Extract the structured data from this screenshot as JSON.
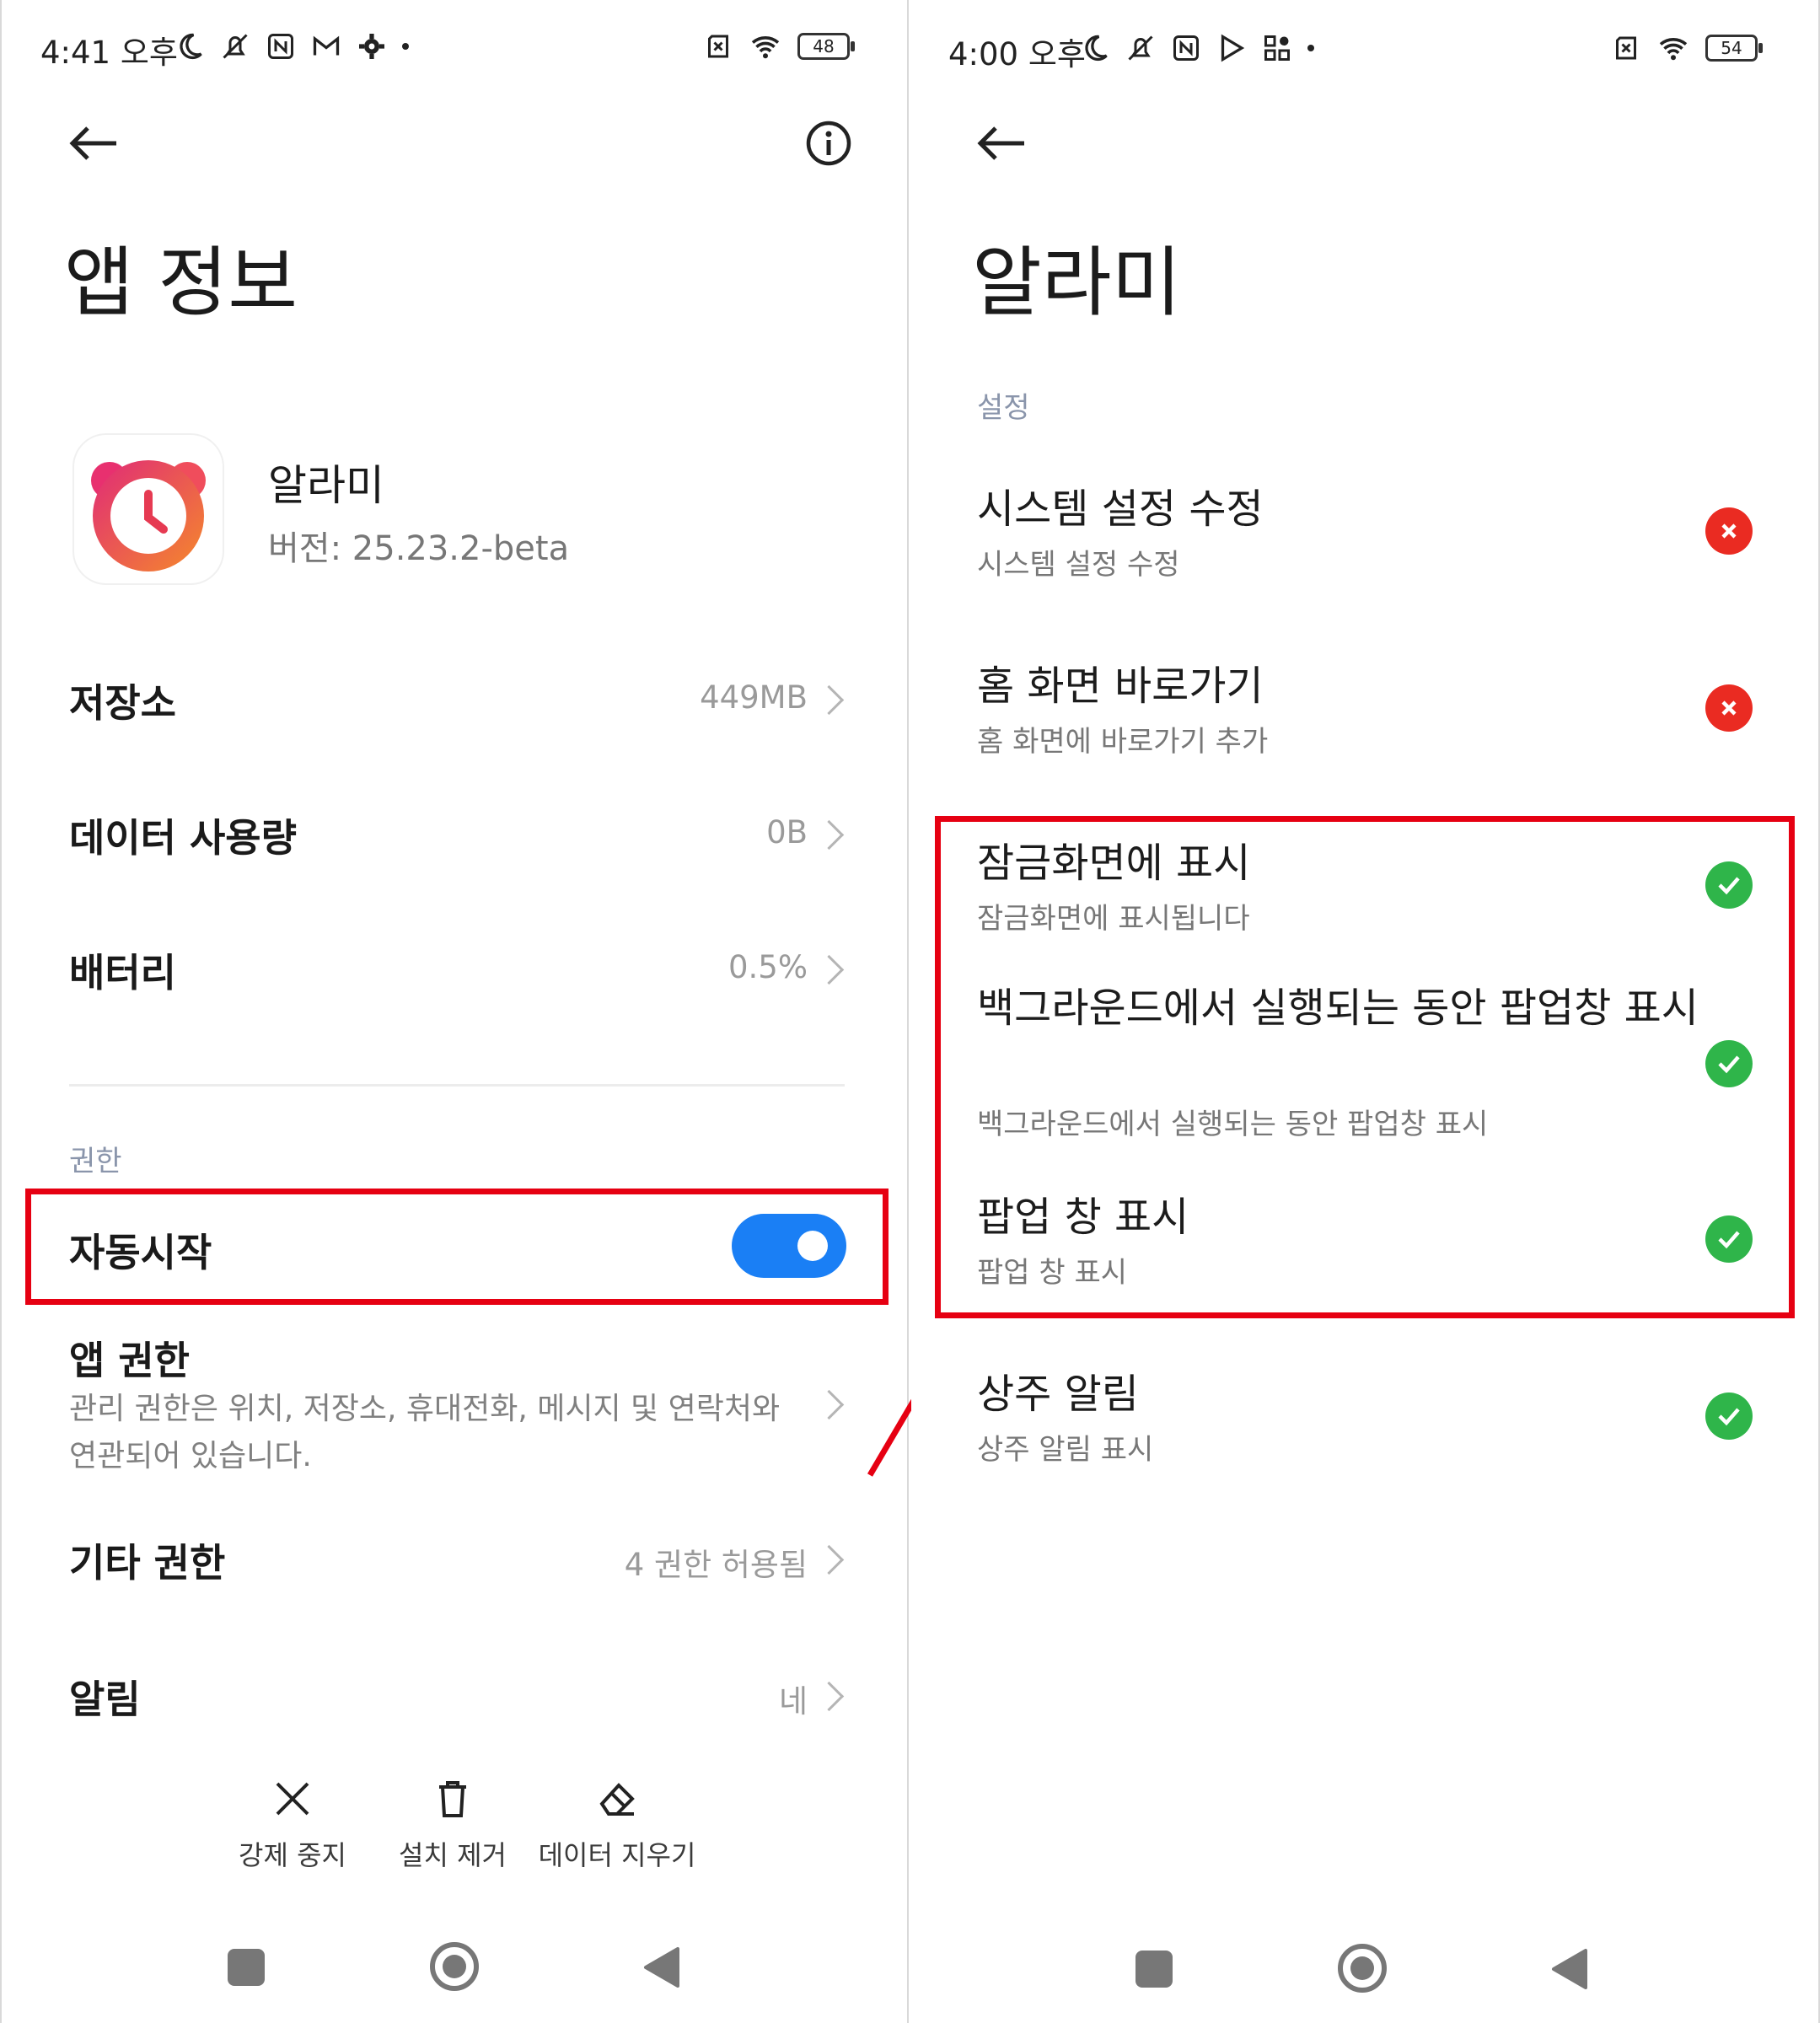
{
  "left": {
    "status": {
      "time": "4:41 오후",
      "battery": "48"
    },
    "title": "앱 정보",
    "app": {
      "name": "알라미",
      "version": "버전: 25.23.2-beta"
    },
    "rows": [
      {
        "label": "저장소",
        "value": "449MB"
      },
      {
        "label": "데이터 사용량",
        "value": "0B"
      },
      {
        "label": "배터리",
        "value": "0.5%"
      }
    ],
    "section_permissions": "권한",
    "autostart": {
      "label": "자동시작",
      "enabled": true
    },
    "app_permissions": {
      "label": "앱 권한",
      "desc": "관리 권한은 위치, 저장소, 휴대전화, 메시지 및 연락처와 연관되어 있습니다."
    },
    "other_permissions": {
      "label": "기타 권한",
      "value": "4 권한 허용됨"
    },
    "notifications": {
      "label": "알림",
      "value": "네"
    },
    "toolbar": {
      "force_stop": "강제 중지",
      "uninstall": "설치 제거",
      "clear_data": "데이터 지우기"
    }
  },
  "right": {
    "status": {
      "time": "4:00 오후",
      "battery": "54"
    },
    "title": "알라미",
    "section": "설정",
    "items": [
      {
        "title": "시스템 설정 수정",
        "sub": "시스템 설정 수정",
        "state": "denied"
      },
      {
        "title": "홈 화면 바로가기",
        "sub": "홈 화면에 바로가기 추가",
        "state": "denied"
      },
      {
        "title": "잠금화면에 표시",
        "sub": "잠금화면에 표시됩니다",
        "state": "allowed"
      },
      {
        "title": "백그라운드에서 실행되는 동안 팝업창 표시",
        "sub": "백그라운드에서 실행되는 동안 팝업창 표시",
        "state": "allowed"
      },
      {
        "title": "팝업 창 표시",
        "sub": "팝업 창 표시",
        "state": "allowed"
      },
      {
        "title": "상주 알림",
        "sub": "상주 알림 표시",
        "state": "allowed"
      }
    ]
  },
  "colors": {
    "highlight": "#e60012",
    "toggle_on": "#1a7ff5",
    "allowed": "#2fb54a",
    "denied": "#ea2b22",
    "arrow": "#e60012"
  },
  "icons": [
    "back-arrow-icon",
    "info-icon",
    "alarm-clock-app-icon",
    "close-icon",
    "trash-icon",
    "eraser-icon",
    "check-icon",
    "x-icon",
    "wifi-icon",
    "battery-icon",
    "moon-icon",
    "nfc-icon"
  ]
}
